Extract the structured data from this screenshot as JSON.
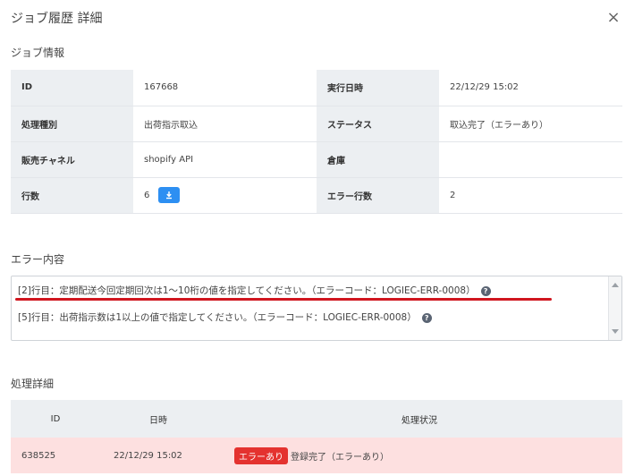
{
  "dialog": {
    "title": "ジョブ履歴 詳細",
    "close_symbol": "×"
  },
  "job_info": {
    "section_title": "ジョブ情報",
    "rows": [
      {
        "label1": "ID",
        "value1": "167668",
        "label2": "実行日時",
        "value2": "22/12/29 15:02"
      },
      {
        "label1": "処理種別",
        "value1": "出荷指示取込",
        "label2": "ステータス",
        "value2": "取込完了（エラーあり）"
      },
      {
        "label1": "販売チャネル",
        "value1": "shopify API",
        "label2": "倉庫",
        "value2": ""
      },
      {
        "label1": "行数",
        "value1": "6",
        "label2": "エラー行数",
        "value2": "2"
      }
    ],
    "download_icon": "download-icon"
  },
  "errors": {
    "section_title": "エラー内容",
    "items": [
      "[2]行目：定期配送今回定期回次は1〜10桁の値を指定してください。（エラーコード：LOGIEC-ERR-0008）",
      "[5]行目：出荷指示数は1以上の値で指定してください。（エラーコード：LOGIEC-ERR-0008）"
    ],
    "help_symbol": "?",
    "highlight_color": "#d0161f"
  },
  "process": {
    "section_title": "処理詳細",
    "headers": [
      "ID",
      "日時",
      "処理状況"
    ],
    "rows": [
      {
        "id": "638525",
        "datetime": "22/12/29 15:02",
        "badge": "エラーあり",
        "status": "登録完了（エラーあり）"
      }
    ]
  },
  "colors": {
    "accent": "#2d8ff2",
    "error_badge": "#e4322f",
    "error_row_bg": "#fde0e0",
    "label_bg": "#eceff2"
  }
}
